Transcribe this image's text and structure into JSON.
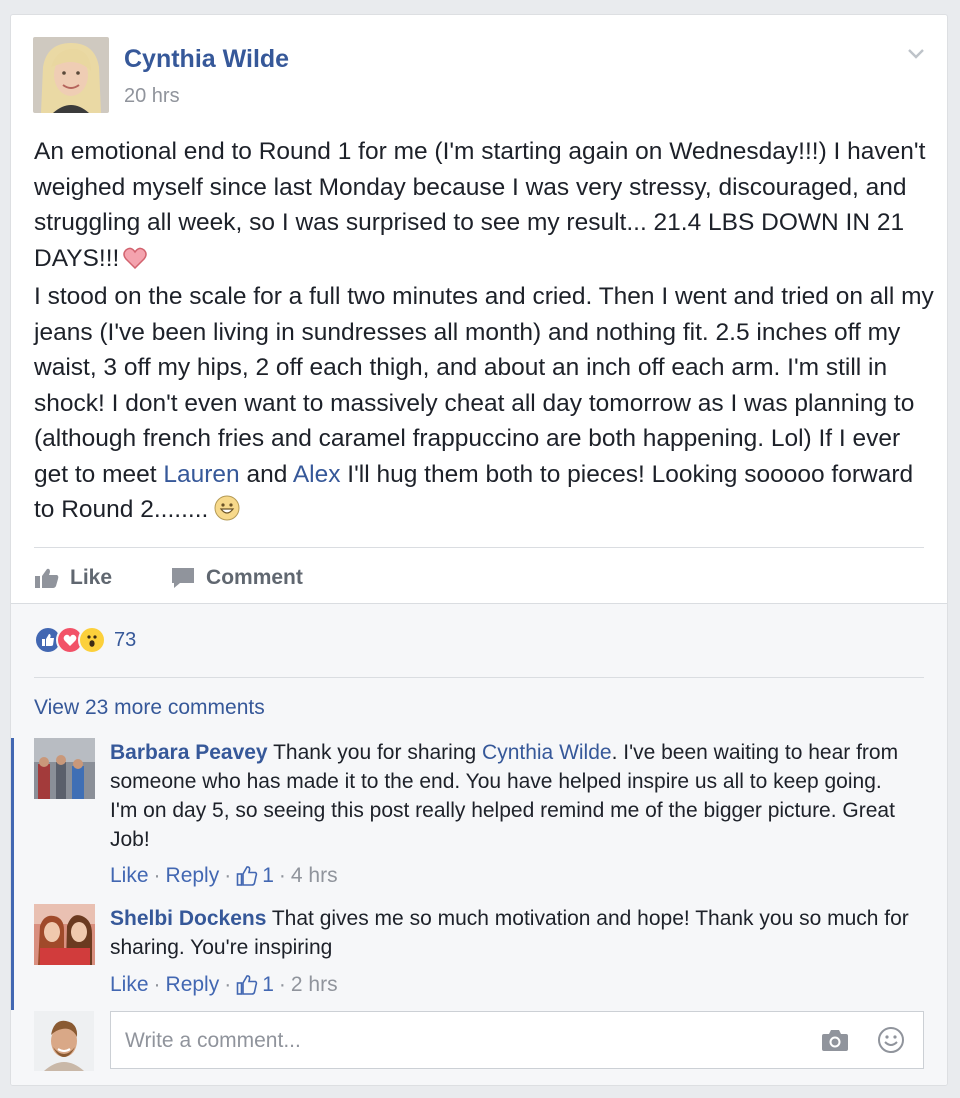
{
  "post": {
    "author": "Cynthia Wilde",
    "time": "20 hrs",
    "text_1": "An emotional end to Round 1 for me (I'm starting again on Wednesday!!!) I haven't weighed myself since last Monday because I was very stressy, discouraged, and struggling all week, so I was surprised to see my result... 21.4 LBS DOWN IN 21 DAYS!!!",
    "text_2a": "I stood on the scale for a full two minutes and cried. Then I went and tried on all my jeans (I've been living in sundresses all month) and nothing fit. 2.5 inches off my waist, 3 off my hips, 2 off each thigh, and about an inch off each arm. I'm still in shock! I don't even want to massively cheat all day tomorrow as I was planning to (although french fries and caramel frappuccino are both happening. Lol) If I ever get to meet ",
    "mention_1": "Lauren",
    "text_2b": " and ",
    "mention_2": "Alex",
    "text_2c": " I'll hug them both to pieces! Looking sooooo forward to Round 2........",
    "icons": [
      "heart-emoji",
      "grinning-emoji",
      "chevron-down-icon"
    ]
  },
  "actions": {
    "like": "Like",
    "comment": "Comment"
  },
  "reactions": {
    "count": "73",
    "icons": [
      "like",
      "love",
      "wow"
    ]
  },
  "comments_section": {
    "view_more": "View 23 more comments",
    "comments": [
      {
        "name": "Barbara Peavey",
        "text_a": " Thank you for sharing ",
        "mention": "Cynthia Wilde",
        "text_b": ". I've been waiting to hear from someone who has made it to the end. You have helped inspire us all to keep going. I'm on day 5, so seeing this post really helped remind me of the bigger picture. Great Job!",
        "like": "Like",
        "reply": "Reply",
        "likes": "1",
        "time": "4 hrs"
      },
      {
        "name": "Shelbi Dockens",
        "text_a": " That gives me so much motivation and hope! Thank you so much for sharing. You're inspiring",
        "like": "Like",
        "reply": "Reply",
        "likes": "1",
        "time": "2 hrs"
      }
    ],
    "write_placeholder": "Write a comment..."
  },
  "colors": {
    "link": "#365899",
    "meta": "#90949c",
    "like_blue": "#4267b2",
    "love_red": "#f25268",
    "wow_yellow": "#fcd03b"
  }
}
